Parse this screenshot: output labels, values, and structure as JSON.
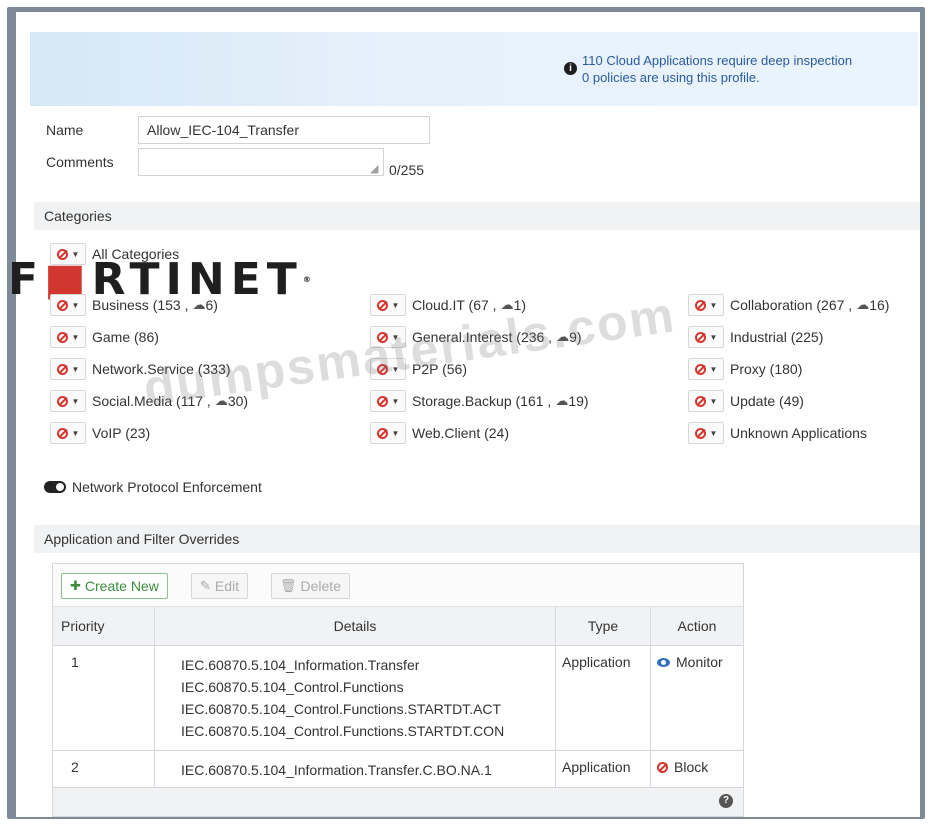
{
  "banner": {
    "line1": "110 Cloud Applications require deep inspection",
    "line2": "0 policies are using this profile."
  },
  "form": {
    "name_label": "Name",
    "name_value": "Allow_IEC-104_Transfer",
    "comments_label": "Comments",
    "comments_value": "",
    "comments_counter": "0/255"
  },
  "categories_section": {
    "title": "Categories",
    "all_label": "All Categories",
    "items": [
      {
        "label": "Business (153 ,",
        "cloud": "6)"
      },
      {
        "label": "Cloud.IT (67 ,",
        "cloud": "1)"
      },
      {
        "label": "Collaboration (267 ,",
        "cloud": "16)"
      },
      {
        "label": "Game (86)",
        "cloud": ""
      },
      {
        "label": "General.Interest (236 ,",
        "cloud": "9)"
      },
      {
        "label": "Industrial (225)",
        "cloud": ""
      },
      {
        "label": "Network.Service (333)",
        "cloud": ""
      },
      {
        "label": "P2P (56)",
        "cloud": ""
      },
      {
        "label": "Proxy (180)",
        "cloud": ""
      },
      {
        "label": "Social.Media (117 ,",
        "cloud": "30)"
      },
      {
        "label": "Storage.Backup (161 ,",
        "cloud": "19)"
      },
      {
        "label": "Update (49)",
        "cloud": ""
      },
      {
        "label": "VoIP (23)",
        "cloud": ""
      },
      {
        "label": "Web.Client (24)",
        "cloud": ""
      },
      {
        "label": "Unknown Applications",
        "cloud": ""
      }
    ]
  },
  "logo_text": "FORTINET",
  "watermark_text": "dumpsmaterials.com",
  "protocol_enforcement": {
    "label": "Network Protocol Enforcement"
  },
  "overrides": {
    "title": "Application and Filter Overrides",
    "toolbar": {
      "create": "Create New",
      "edit": "Edit",
      "delete": "Delete"
    },
    "columns": {
      "priority": "Priority",
      "details": "Details",
      "type": "Type",
      "action": "Action"
    },
    "rows": [
      {
        "priority": "1",
        "details": [
          "IEC.60870.5.104_Information.Transfer",
          "IEC.60870.5.104_Control.Functions",
          "IEC.60870.5.104_Control.Functions.STARTDT.ACT",
          "IEC.60870.5.104_Control.Functions.STARTDT.CON"
        ],
        "type": "Application",
        "action": "Monitor"
      },
      {
        "priority": "2",
        "details": [
          "IEC.60870.5.104_Information.Transfer.C.BO.NA.1"
        ],
        "type": "Application",
        "action": "Block"
      }
    ]
  },
  "colors": {
    "block_red": "#d2372f",
    "monitor_blue": "#2f6fc4",
    "create_green": "#3a8d3a"
  }
}
